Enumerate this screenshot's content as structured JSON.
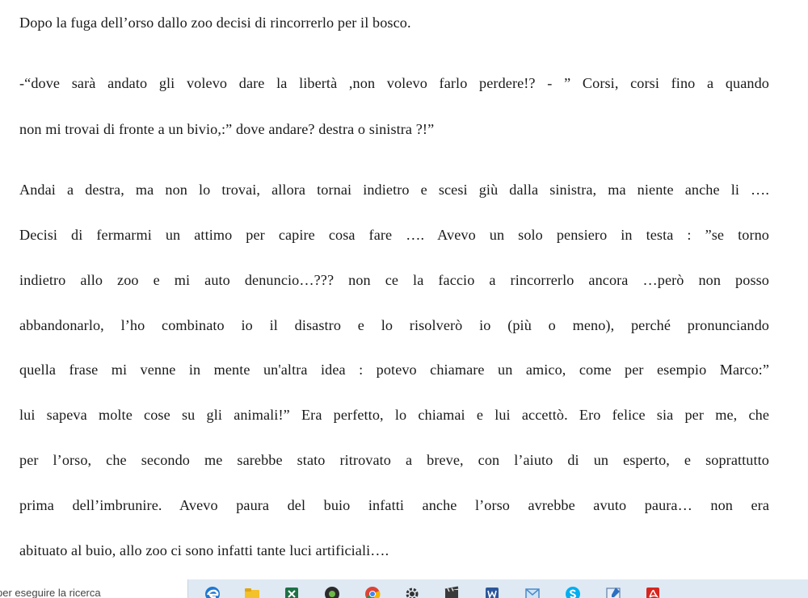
{
  "document": {
    "lines": [
      "Dopo la fuga dell’orso dallo zoo decisi di rincorrerlo per il bosco.",
      "-“dove sarà andato gli volevo dare la libertà ,non volevo farlo perdere!? - ”  Corsi, corsi  fino a quando",
      "non mi trovai di fronte a un bivio,:” dove andare? destra o sinistra ?!”",
      "Andai a destra, ma non lo trovai, allora tornai indietro e scesi giù dalla sinistra,  ma niente anche li ….",
      "Decisi di fermarmi un attimo per capire cosa fare …. Avevo un solo pensiero in testa : ”se torno",
      "indietro allo zoo e mi auto denuncio…??? non ce la faccio a rincorrerlo ancora …però non posso",
      "abbandonarlo, l’ho combinato io il disastro e lo risolverò io (più o meno), perché pronunciando",
      "quella frase mi venne in mente un'altra idea : potevo chiamare un amico, come per esempio Marco:”",
      "lui sapeva molte cose su gli animali!” Era perfetto, lo chiamai e lui accettò.  Ero felice sia per me, che",
      "per l’orso, che secondo me sarebbe stato ritrovato a breve, con l’aiuto di un esperto, e soprattutto",
      "prima dell’imbrunire. Avevo paura del buio infatti anche l’orso avrebbe avuto paura… non era",
      "abituato al buio, allo zoo ci sono infatti tante luci artificiali…."
    ]
  },
  "taskbar": {
    "search_text": "per eseguire la ricerca",
    "icons": [
      "edge-icon",
      "file-explorer-icon",
      "excel-icon",
      "media-icon",
      "chrome-icon",
      "settings-icon",
      "film-icon",
      "word-icon",
      "mail-icon",
      "skype-icon",
      "paint-icon",
      "acrobat-icon"
    ]
  }
}
